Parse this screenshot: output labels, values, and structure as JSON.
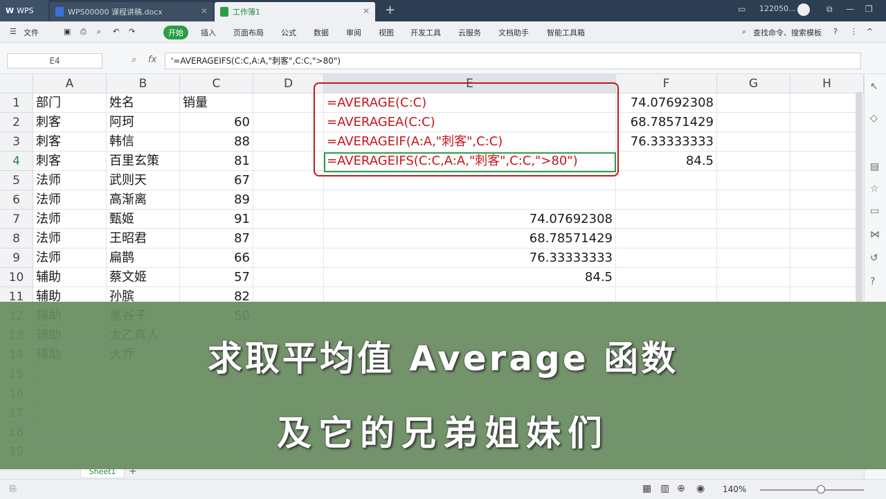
{
  "tabs": {
    "wps": "WPS",
    "doc": "WPS00000 课程讲稿.docx",
    "sheet": "工作簿1"
  },
  "user": "122050...",
  "menu": {
    "file": "文件",
    "start": "开始",
    "insert": "插入",
    "layout": "页面布局",
    "formula": "公式",
    "data": "数据",
    "review": "审阅",
    "view": "视图",
    "dev": "开发工具",
    "cloud": "云服务",
    "dochelper": "文档助手",
    "smart": "智能工具箱",
    "search": "查找命令、搜索模板"
  },
  "formula_bar": {
    "cell_ref": "E4",
    "fx": "fx",
    "content": "'=AVERAGEIFS(C:C,A:A,\"刺客\",C:C,\">80\")"
  },
  "columns": [
    "A",
    "B",
    "C",
    "D",
    "E",
    "F",
    "G",
    "H"
  ],
  "rows": [
    {
      "n": "1",
      "a": "部门",
      "b": "姓名",
      "c": "销量",
      "e": "=AVERAGE(C:C)",
      "f": "74.07692308"
    },
    {
      "n": "2",
      "a": "刺客",
      "b": "阿珂",
      "c": "60",
      "e": "=AVERAGEA(C:C)",
      "f": "68.78571429"
    },
    {
      "n": "3",
      "a": "刺客",
      "b": "韩信",
      "c": "88",
      "e": "=AVERAGEIF(A:A,\"刺客\",C:C)",
      "f": "76.33333333"
    },
    {
      "n": "4",
      "a": "刺客",
      "b": "百里玄策",
      "c": "81",
      "e": "=AVERAGEIFS(C:C,A:A,\"刺客\",C:C,\">80\")",
      "f": "84.5"
    },
    {
      "n": "5",
      "a": "法师",
      "b": "武则天",
      "c": "67",
      "e": "",
      "f": ""
    },
    {
      "n": "6",
      "a": "法师",
      "b": "高渐离",
      "c": "89",
      "e": "",
      "f": ""
    },
    {
      "n": "7",
      "a": "法师",
      "b": "甄姬",
      "c": "91",
      "e": "74.07692308",
      "f": ""
    },
    {
      "n": "8",
      "a": "法师",
      "b": "王昭君",
      "c": "87",
      "e": "68.78571429",
      "f": ""
    },
    {
      "n": "9",
      "a": "法师",
      "b": "扁鹊",
      "c": "66",
      "e": "76.33333333",
      "f": ""
    },
    {
      "n": "10",
      "a": "辅助",
      "b": "蔡文姬",
      "c": "57",
      "e": "84.5",
      "f": ""
    },
    {
      "n": "11",
      "a": "辅助",
      "b": "孙膑",
      "c": "82",
      "e": "",
      "f": ""
    },
    {
      "n": "12",
      "a": "辅助",
      "b": "鬼谷子",
      "c": "50",
      "e": "",
      "f": ""
    },
    {
      "n": "13",
      "a": "辅助",
      "b": "太乙真人",
      "c": "",
      "e": "",
      "f": ""
    },
    {
      "n": "14",
      "a": "辅助",
      "b": "大乔",
      "c": "",
      "e": "",
      "f": ""
    },
    {
      "n": "15",
      "a": "",
      "b": "",
      "c": "",
      "e": "",
      "f": ""
    },
    {
      "n": "16",
      "a": "",
      "b": "",
      "c": "",
      "e": "",
      "f": ""
    },
    {
      "n": "17",
      "a": "",
      "b": "",
      "c": "",
      "e": "",
      "f": ""
    },
    {
      "n": "18",
      "a": "",
      "b": "",
      "c": "",
      "e": "",
      "f": ""
    },
    {
      "n": "19",
      "a": "",
      "b": "",
      "c": "",
      "e": "",
      "f": ""
    }
  ],
  "sheet_tab": "Sheet1",
  "zoom": "140%",
  "overlay": {
    "line1": "求取平均值 Average 函数",
    "line2": "及它的兄弟姐妹们"
  },
  "colors": {
    "accent": "#2a9d45",
    "highlight": "#c4161c"
  }
}
